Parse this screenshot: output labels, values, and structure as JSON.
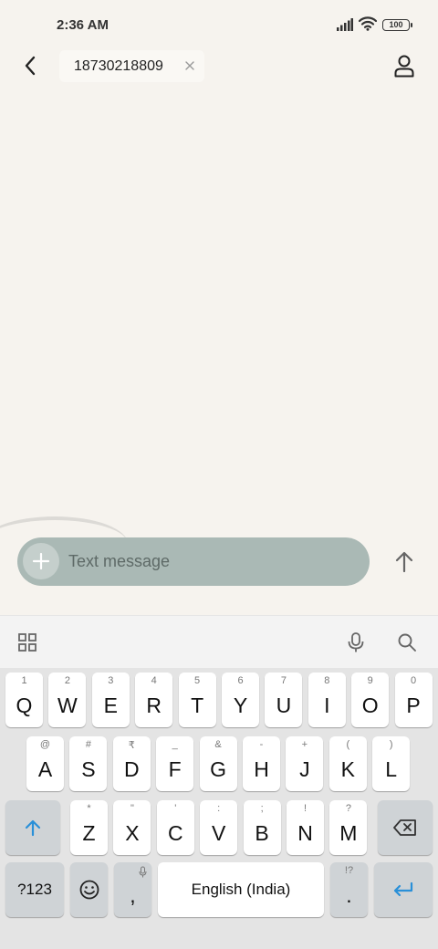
{
  "status": {
    "time": "2:36 AM",
    "battery": "100"
  },
  "header": {
    "recipient": "18730218809"
  },
  "composer": {
    "placeholder": "Text message"
  },
  "keyboard": {
    "rows": [
      [
        {
          "label": "Q",
          "hint": "1"
        },
        {
          "label": "W",
          "hint": "2"
        },
        {
          "label": "E",
          "hint": "3"
        },
        {
          "label": "R",
          "hint": "4"
        },
        {
          "label": "T",
          "hint": "5"
        },
        {
          "label": "Y",
          "hint": "6"
        },
        {
          "label": "U",
          "hint": "7"
        },
        {
          "label": "I",
          "hint": "8"
        },
        {
          "label": "O",
          "hint": "9"
        },
        {
          "label": "P",
          "hint": "0"
        }
      ],
      [
        {
          "label": "A",
          "hint": "@"
        },
        {
          "label": "S",
          "hint": "#"
        },
        {
          "label": "D",
          "hint": "₹"
        },
        {
          "label": "F",
          "hint": "_"
        },
        {
          "label": "G",
          "hint": "&"
        },
        {
          "label": "H",
          "hint": "-"
        },
        {
          "label": "J",
          "hint": "+"
        },
        {
          "label": "K",
          "hint": "("
        },
        {
          "label": "L",
          "hint": ")"
        }
      ],
      [
        {
          "label": "Z",
          "hint": "*"
        },
        {
          "label": "X",
          "hint": "\""
        },
        {
          "label": "C",
          "hint": "'"
        },
        {
          "label": "V",
          "hint": ":"
        },
        {
          "label": "B",
          "hint": ";"
        },
        {
          "label": "N",
          "hint": "!"
        },
        {
          "label": "M",
          "hint": "?"
        }
      ]
    ],
    "symbols_label": "?123",
    "comma_label": ",",
    "space_label": "English (India)",
    "period_label": ".",
    "period_hint": "!?"
  },
  "colors": {
    "background": "#f6f3ee",
    "compose_bar": "#aab9b5",
    "accent": "#2a90d8"
  }
}
